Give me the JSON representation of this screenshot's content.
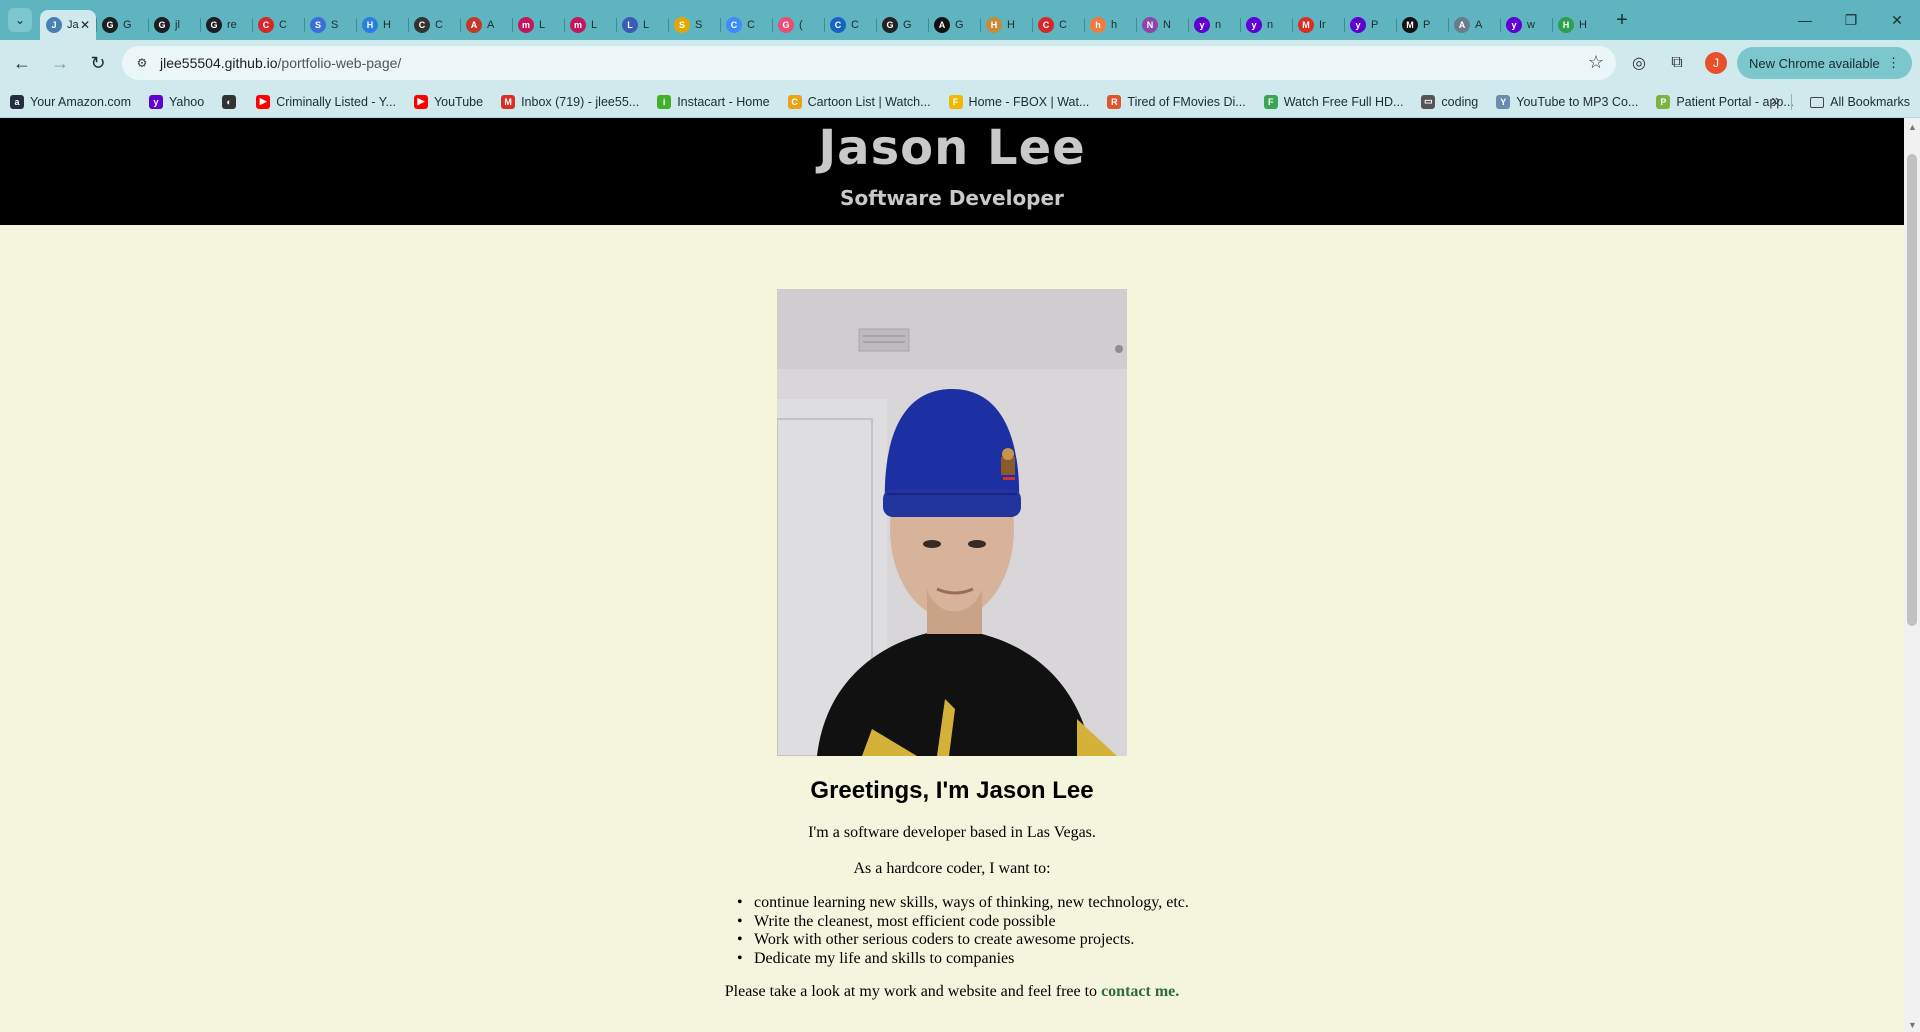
{
  "browser": {
    "tabs": [
      {
        "label": "Ja",
        "color": "#4a7fb5",
        "glyph": "J",
        "active": true
      },
      {
        "label": "G",
        "color": "#1b1f23",
        "glyph": "G"
      },
      {
        "label": "jl",
        "color": "#1b1f23",
        "glyph": "G"
      },
      {
        "label": "re",
        "color": "#1b1f23",
        "glyph": "G"
      },
      {
        "label": "C",
        "color": "#d62828",
        "glyph": "C"
      },
      {
        "label": "S",
        "color": "#3b6fd8",
        "glyph": "S"
      },
      {
        "label": "H",
        "color": "#2a7de1",
        "glyph": "H"
      },
      {
        "label": "C",
        "color": "#333333",
        "glyph": "C"
      },
      {
        "label": "A",
        "color": "#c0392b",
        "glyph": "A"
      },
      {
        "label": "L",
        "color": "#c2185b",
        "glyph": "m"
      },
      {
        "label": "L",
        "color": "#c2185b",
        "glyph": "m"
      },
      {
        "label": "L",
        "color": "#3a5bb8",
        "glyph": "L"
      },
      {
        "label": "S",
        "color": "#e0a800",
        "glyph": "S"
      },
      {
        "label": "C",
        "color": "#3d8bfd",
        "glyph": "C"
      },
      {
        "label": "(",
        "color": "#e94e77",
        "glyph": "G"
      },
      {
        "label": "C",
        "color": "#1565c0",
        "glyph": "C"
      },
      {
        "label": "G",
        "color": "#222222",
        "glyph": "G"
      },
      {
        "label": "G",
        "color": "#111111",
        "glyph": "A"
      },
      {
        "label": "H",
        "color": "#c58b3a",
        "glyph": "H"
      },
      {
        "label": "C",
        "color": "#d62828",
        "glyph": "C"
      },
      {
        "label": "h",
        "color": "#f07b3f",
        "glyph": "h"
      },
      {
        "label": "N",
        "color": "#8e44ad",
        "glyph": "N"
      },
      {
        "label": "n",
        "color": "#6001d2",
        "glyph": "y"
      },
      {
        "label": "n",
        "color": "#6001d2",
        "glyph": "y"
      },
      {
        "label": "Ir",
        "color": "#d93025",
        "glyph": "M"
      },
      {
        "label": "P",
        "color": "#6001d2",
        "glyph": "y"
      },
      {
        "label": "P",
        "color": "#111111",
        "glyph": "M"
      },
      {
        "label": "A",
        "color": "#6b7b8c",
        "glyph": "A"
      },
      {
        "label": "w",
        "color": "#6001d2",
        "glyph": "y"
      },
      {
        "label": "H",
        "color": "#2e9e4f",
        "glyph": "H"
      }
    ],
    "url_host": "jlee55504.github.io",
    "url_path": "/portfolio-web-page/",
    "profile_initial": "J",
    "update_label": "New Chrome available",
    "bookmarks": [
      {
        "label": "Your Amazon.com",
        "color": "#232f3e",
        "glyph": "a"
      },
      {
        "label": "Yahoo",
        "color": "#6001d2",
        "glyph": "y"
      },
      {
        "label": "",
        "color": "#333333",
        "glyph": "◐"
      },
      {
        "label": "Criminally Listed - Y...",
        "color": "#ff0000",
        "glyph": "▶"
      },
      {
        "label": "YouTube",
        "color": "#ff0000",
        "glyph": "▶"
      },
      {
        "label": "Inbox (719) - jlee55...",
        "color": "#d93025",
        "glyph": "M"
      },
      {
        "label": "Instacart - Home",
        "color": "#43b02a",
        "glyph": "i"
      },
      {
        "label": "Cartoon List | Watch...",
        "color": "#e8a317",
        "glyph": "C"
      },
      {
        "label": "Home - FBOX | Wat...",
        "color": "#f2b705",
        "glyph": "F"
      },
      {
        "label": "Tired of FMovies Di...",
        "color": "#e0552f",
        "glyph": "R"
      },
      {
        "label": "Watch Free Full HD...",
        "color": "#3aa655",
        "glyph": "F"
      },
      {
        "label": "coding",
        "color": "#555555",
        "glyph": "▭"
      },
      {
        "label": "YouTube to MP3 Co...",
        "color": "#6a8caf",
        "glyph": "Y"
      },
      {
        "label": "Patient Portal - app...",
        "color": "#7cb342",
        "glyph": "P"
      }
    ],
    "all_bookmarks_label": "All Bookmarks"
  },
  "site": {
    "name": "Jason Lee",
    "role": "Software Developer",
    "greeting": "Greetings, I'm Jason Lee",
    "intro": "I'm a software developer based in Las Vegas.",
    "lead": "As a hardcore coder, I want to:",
    "goals": [
      "continue learning new skills, ways of thinking, new technology, etc.",
      "Write the cleanest, most efficient code possible",
      "Work with other serious coders to create awesome projects.",
      "Dedicate my life and skills to companies"
    ],
    "closing": "Please take a look at my work and website and feel free to ",
    "contact_link": "contact me."
  },
  "colors": {
    "tabstrip": "#5fb5bf",
    "toolbar": "#cfe9ec",
    "page_bg": "#f5f4dc",
    "header_bg": "#000000",
    "header_text": "#c9c9c9",
    "link": "#2e6b3e"
  }
}
